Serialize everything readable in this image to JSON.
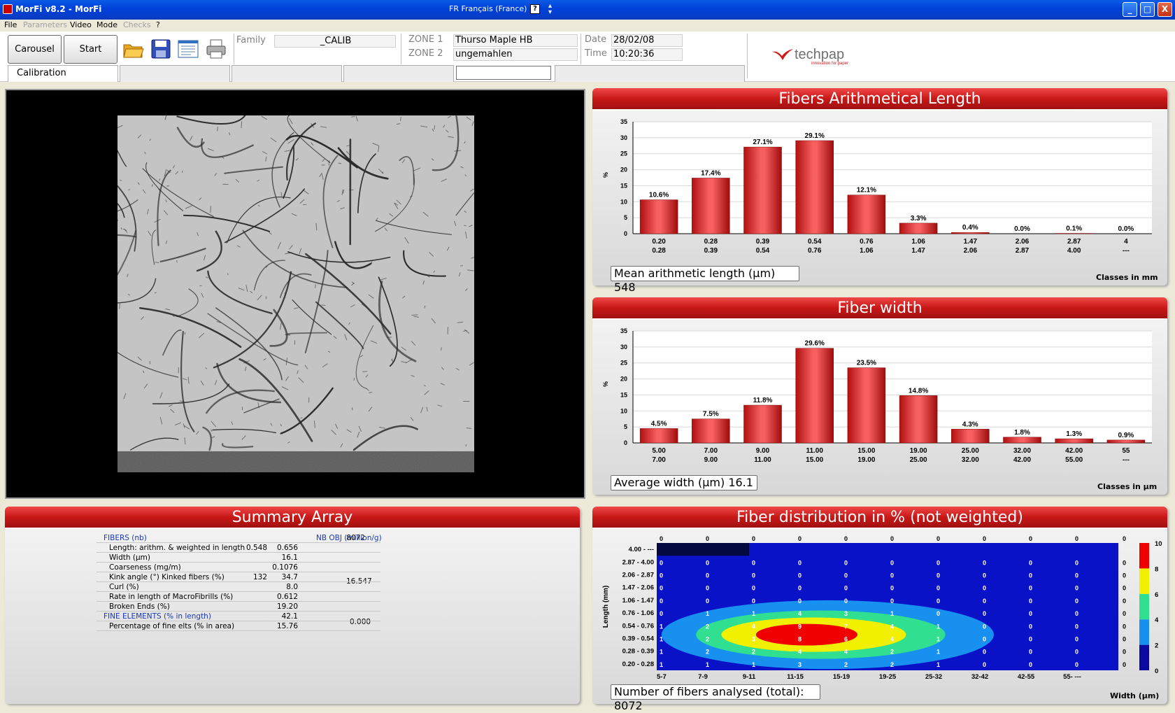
{
  "window": {
    "title": "MorFi v8.2 - MorFi",
    "language": "FR Français (France)",
    "help_symbol": "?",
    "minimize": "_",
    "maximize": "□",
    "close": "X"
  },
  "menu": [
    {
      "label": "File",
      "enabled": true
    },
    {
      "label": "Parameters",
      "enabled": false
    },
    {
      "label": "Video",
      "enabled": true
    },
    {
      "label": "Mode",
      "enabled": true
    },
    {
      "label": "Checks",
      "enabled": false
    },
    {
      "label": "?",
      "enabled": true
    }
  ],
  "toolbar": {
    "carousel_label": "Carousel",
    "start_label": "Start"
  },
  "info": {
    "family_label": "Family",
    "family_value": "_CALIB",
    "zone1_label": "ZONE 1",
    "zone1_value": "Thurso Maple HB",
    "zone2_label": "ZONE 2",
    "zone2_value": "ungemahlen",
    "date_label": "Date",
    "date_value": "28/02/08",
    "time_label": "Time",
    "time_value": "10:20:36"
  },
  "tabs": {
    "active": "Calibration"
  },
  "logo": {
    "name": "techpap",
    "tagline": "innovation for paper"
  },
  "length_chart": {
    "title": "Fibers Arithmetical Length",
    "mean_label": "Mean arithmetic length (µm) 548",
    "classes_label": "Classes in mm",
    "chart_data": {
      "type": "bar",
      "ylabel": "%",
      "ylim": [
        0,
        35
      ],
      "yticks": [
        0,
        5,
        10,
        15,
        20,
        25,
        30,
        35
      ],
      "categories": [
        [
          "0.20",
          "0.28"
        ],
        [
          "0.28",
          "0.39"
        ],
        [
          "0.39",
          "0.54"
        ],
        [
          "0.54",
          "0.76"
        ],
        [
          "0.76",
          "1.06"
        ],
        [
          "1.06",
          "1.47"
        ],
        [
          "1.47",
          "2.06"
        ],
        [
          "2.06",
          "2.87"
        ],
        [
          "2.87",
          "4.00"
        ],
        [
          "4",
          "---"
        ]
      ],
      "values": [
        10.6,
        17.4,
        27.1,
        29.1,
        12.1,
        3.3,
        0.4,
        0.0,
        0.1,
        0.0
      ],
      "labels": [
        "10.6%",
        "17.4%",
        "27.1%",
        "29.1%",
        "12.1%",
        "3.3%",
        "0.4%",
        "0.0%",
        "0.1%",
        "0.0%"
      ]
    }
  },
  "width_chart": {
    "title": "Fiber width",
    "mean_label": "Average width (µm) 16.1",
    "classes_label": "Classes in µm",
    "chart_data": {
      "type": "bar",
      "ylabel": "%",
      "ylim": [
        0,
        35
      ],
      "yticks": [
        0,
        5,
        10,
        15,
        20,
        25,
        30,
        35
      ],
      "categories": [
        [
          "5.00",
          "7.00"
        ],
        [
          "7.00",
          "9.00"
        ],
        [
          "9.00",
          "11.00"
        ],
        [
          "11.00",
          "15.00"
        ],
        [
          "15.00",
          "19.00"
        ],
        [
          "19.00",
          "25.00"
        ],
        [
          "25.00",
          "32.00"
        ],
        [
          "32.00",
          "42.00"
        ],
        [
          "42.00",
          "55.00"
        ],
        [
          "55",
          "---"
        ]
      ],
      "values": [
        4.5,
        7.5,
        11.8,
        29.6,
        23.5,
        14.8,
        4.3,
        1.8,
        1.3,
        0.9
      ],
      "labels": [
        "4.5%",
        "7.5%",
        "11.8%",
        "29.6%",
        "23.5%",
        "14.8%",
        "4.3%",
        "1.8%",
        "1.3%",
        "0.9%"
      ]
    }
  },
  "summary": {
    "title": "Summary Array",
    "fibers_label": "FIBERS  (nb)",
    "fibers_value": "8072",
    "nb_obj_label": "NB OBJ (million/g)",
    "nb_obj_fibers": "16.547",
    "nb_obj_fines": "0.000",
    "rows": [
      {
        "label": "Length: arithm. & weighted in length",
        "v1": "0.548",
        "v2": "0.656"
      },
      {
        "label": "Width (µm)",
        "v1": "",
        "v2": "16.1"
      },
      {
        "label": "Coarseness (mg/m)",
        "v1": "",
        "v2": "0.1076"
      },
      {
        "label": "Kink angle (°)   Kinked fibers (%)",
        "v1": "132",
        "v2": "34.7"
      },
      {
        "label": "Curl (%)",
        "v1": "",
        "v2": "8.0"
      },
      {
        "label": "Rate in length of MacroFibrills (%)",
        "v1": "",
        "v2": "0.612"
      },
      {
        "label": "Broken Ends (%)",
        "v1": "",
        "v2": "19.20"
      }
    ],
    "fines_label": "FINE ELEMENTS  (% in length)",
    "fines_value": "42.1",
    "fines_area_label": "Percentage of fine elts (% in area)",
    "fines_area_value": "15.76"
  },
  "distribution": {
    "title": "Fiber distribution in % (not weighted)",
    "total_label": "Number of fibers analysed (total): 8072",
    "ylabel": "Length (mm)",
    "xlabel": "Width (µm)",
    "chart_data": {
      "type": "heatmap",
      "x": [
        "5-7",
        "7-9",
        "9-11",
        "11-15",
        "15-19",
        "19-25",
        "25-32",
        "32-42",
        "42-55",
        "55- ---"
      ],
      "y": [
        "4.00 - ---",
        "2.87 - 4.00",
        "2.06 - 2.87",
        "1.47 - 2.06",
        "1.06 - 1.47",
        "0.76 - 1.06",
        "0.54 - 0.76",
        "0.39 - 0.54",
        "0.28 - 0.39",
        "0.20 - 0.28"
      ],
      "values": [
        [
          0,
          0,
          0,
          0,
          0,
          0,
          0,
          0,
          0,
          0
        ],
        [
          0,
          0,
          0,
          0,
          0,
          0,
          0,
          0,
          0,
          0
        ],
        [
          0,
          0,
          0,
          0,
          0,
          0,
          0,
          0,
          0,
          0
        ],
        [
          0,
          0,
          0,
          0,
          0,
          0,
          0,
          0,
          0,
          0
        ],
        [
          0,
          0,
          0,
          0,
          0,
          0,
          0,
          0,
          0,
          0
        ],
        [
          0,
          1,
          1,
          4,
          3,
          1,
          0,
          0,
          0,
          0
        ],
        [
          1,
          2,
          4,
          9,
          7,
          4,
          1,
          0,
          0,
          0
        ],
        [
          1,
          2,
          3,
          8,
          6,
          4,
          1,
          0,
          0,
          0
        ],
        [
          1,
          2,
          2,
          4,
          4,
          2,
          1,
          0,
          0,
          0
        ],
        [
          1,
          1,
          1,
          3,
          2,
          2,
          1,
          0,
          0,
          0
        ]
      ],
      "scale_ticks": [
        0,
        2,
        4,
        6,
        8,
        10
      ],
      "scale_colors": [
        "#0a0aa0",
        "#1890f0",
        "#30e090",
        "#f0f000",
        "#f00000"
      ]
    }
  }
}
